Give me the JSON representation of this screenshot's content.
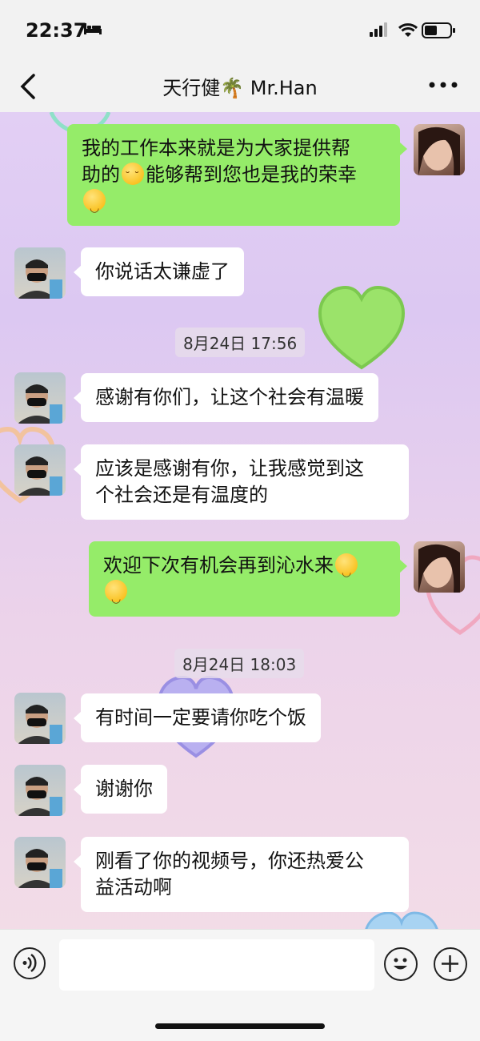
{
  "status_bar": {
    "time": "22:37"
  },
  "nav": {
    "title": "天行健🌴 Mr.Han"
  },
  "colors": {
    "my_bubble": "#95ec69",
    "their_bubble": "#ffffff",
    "bar_bg": "#f2f2f2"
  },
  "messages": [
    {
      "side": "right",
      "segments": [
        "我的工作本来就是为大家提供帮",
        "助的",
        "能够帮到您也是我的荣幸"
      ]
    },
    {
      "side": "left",
      "text": "你说话太谦虚了"
    },
    {
      "timestamp": "8月24日 17:56"
    },
    {
      "side": "left",
      "text": "感谢有你们，让这个社会有温暖"
    },
    {
      "side": "left",
      "lines": [
        "应该是感谢有你，让我感觉到这",
        "个社会还是有温度的"
      ]
    },
    {
      "side": "right",
      "text": "欢迎下次有机会再到沁水来"
    },
    {
      "timestamp": "8月24日 18:03"
    },
    {
      "side": "left",
      "text": "有时间一定要请你吃个饭"
    },
    {
      "side": "left",
      "text": "谢谢你"
    },
    {
      "side": "left",
      "lines": [
        "刚看了你的视频号，你还热爱公",
        "益活动啊"
      ]
    }
  ],
  "icons": {
    "back": "chevron-left-icon",
    "more": "more-icon",
    "voice": "voice-icon",
    "emoji": "emoji-icon",
    "plus": "plus-icon",
    "sleep": "bed-icon",
    "signal": "signal-icon",
    "wifi": "wifi-icon",
    "battery": "battery-icon"
  }
}
